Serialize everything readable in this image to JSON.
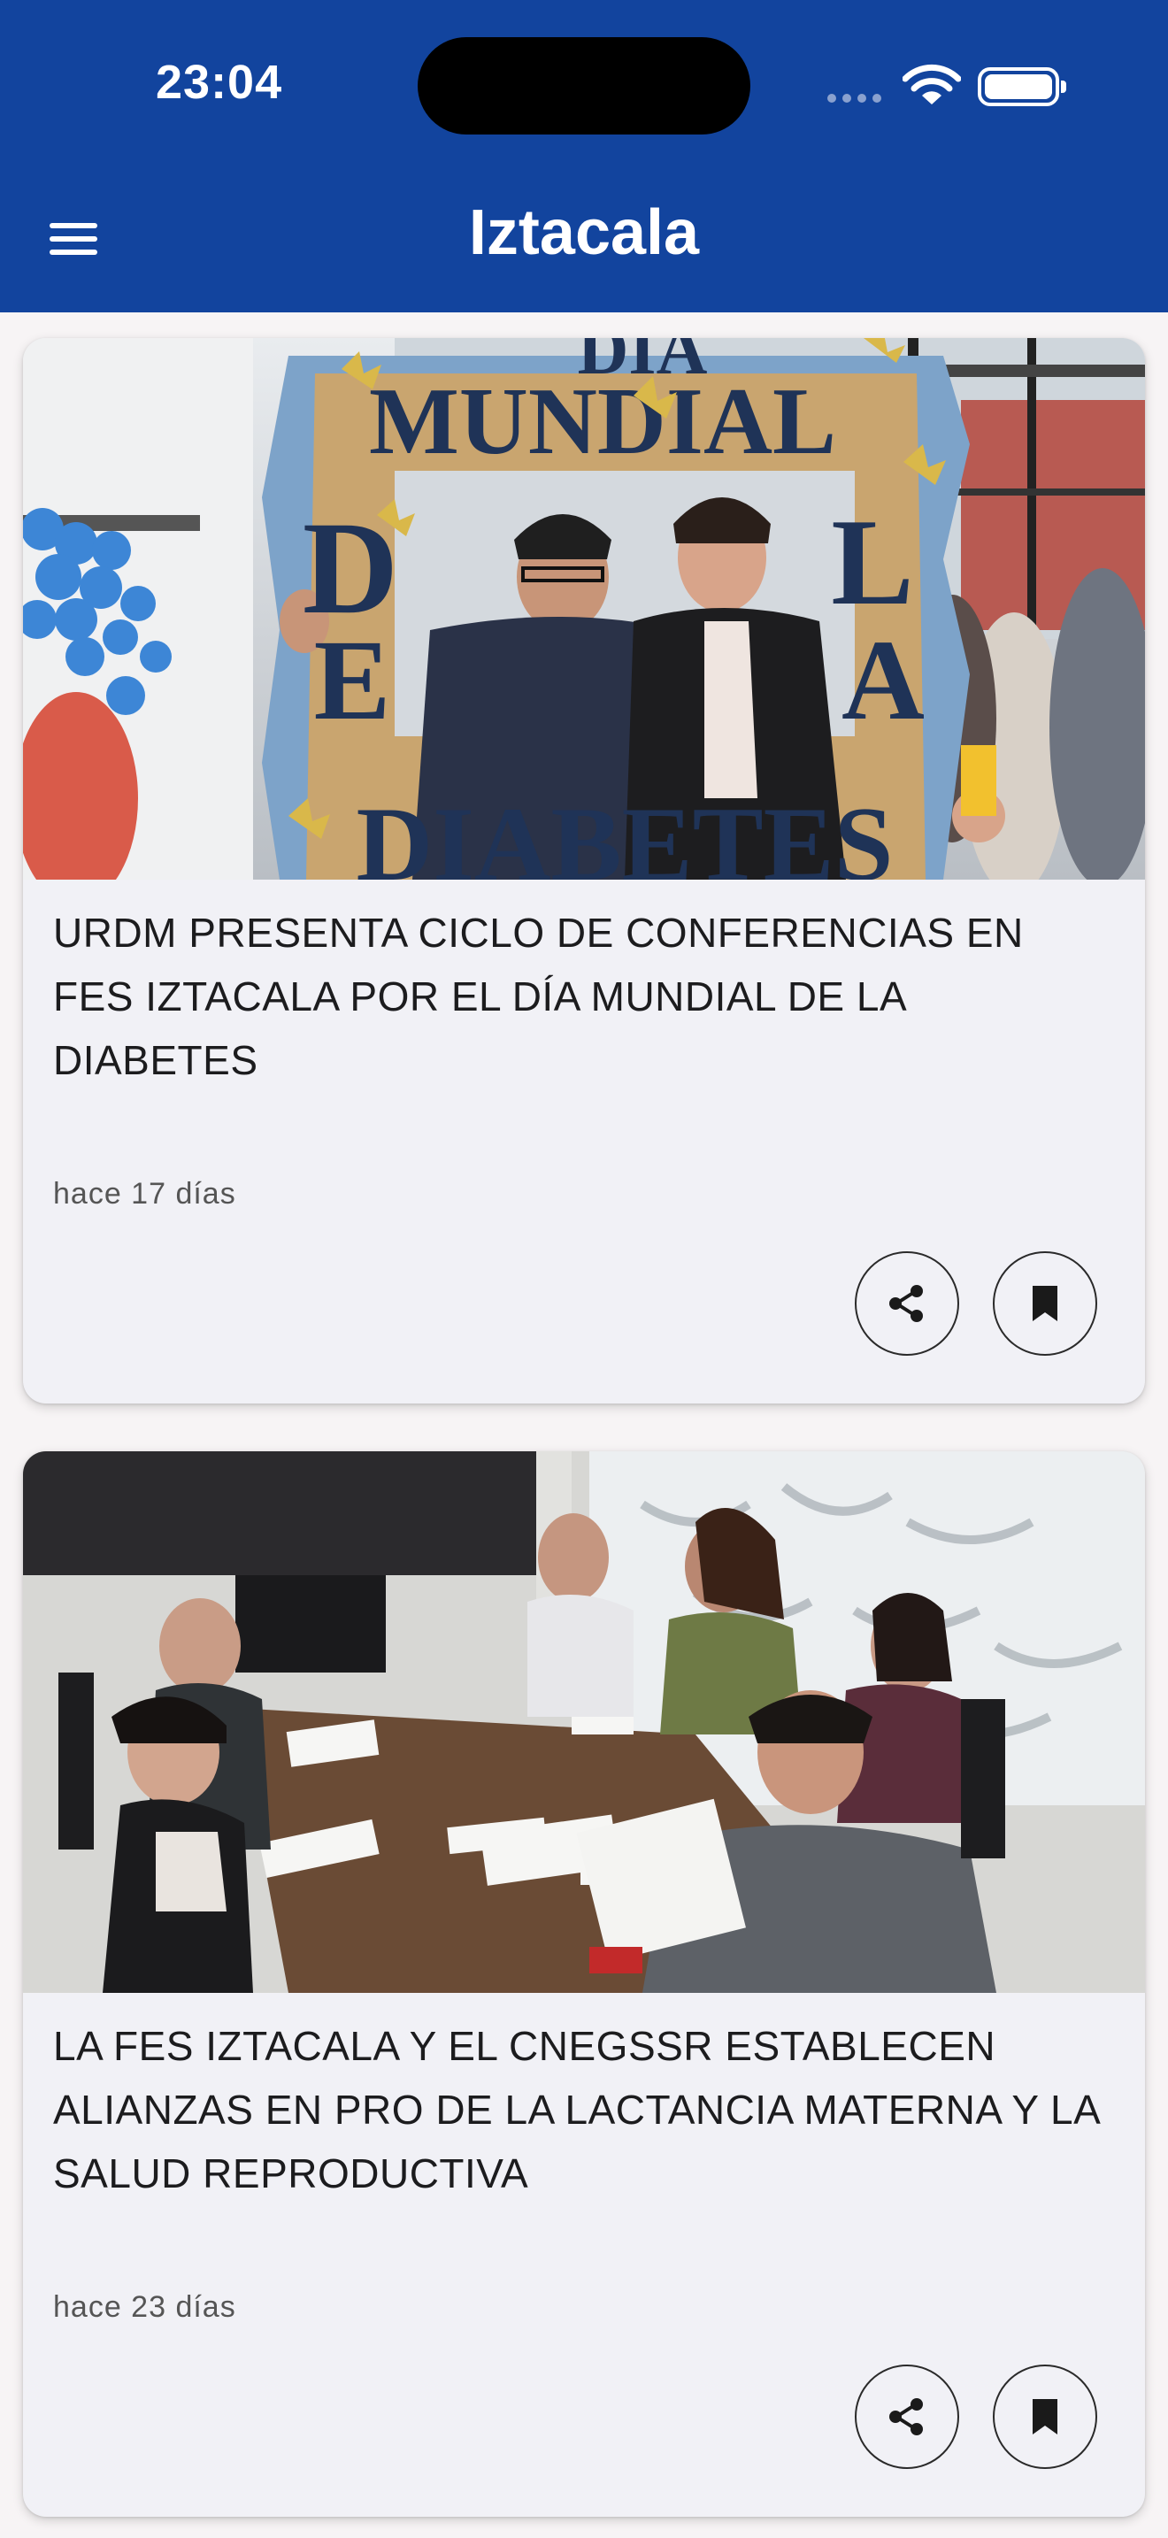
{
  "status_bar": {
    "time": "23:04"
  },
  "header": {
    "title": "Iztacala"
  },
  "articles": [
    {
      "title": "URDM PRESENTA CICLO DE CONFERENCIAS EN FES IZTACALA POR EL DÍA MUNDIAL DE LA DIABETES",
      "date": "hace 17 días",
      "image_text_top": "DIA",
      "image_text_mid": "MUNDIAL",
      "image_text_left_1": "D",
      "image_text_left_2": "E",
      "image_text_right_1": "L",
      "image_text_right_2": "A",
      "image_text_bottom": "DIABETES"
    },
    {
      "title": "LA FES IZTACALA Y EL CNEGSSR ESTABLECEN ALIANZAS EN PRO DE LA LACTANCIA MATERNA Y LA SALUD REPRODUCTIVA",
      "date": "hace 23 días"
    }
  ],
  "icons": {
    "menu": "menu-icon",
    "share": "share-icon",
    "bookmark": "bookmark-icon"
  },
  "colors": {
    "header_bg": "#12449e",
    "card_bg": "#f1f1f6"
  }
}
